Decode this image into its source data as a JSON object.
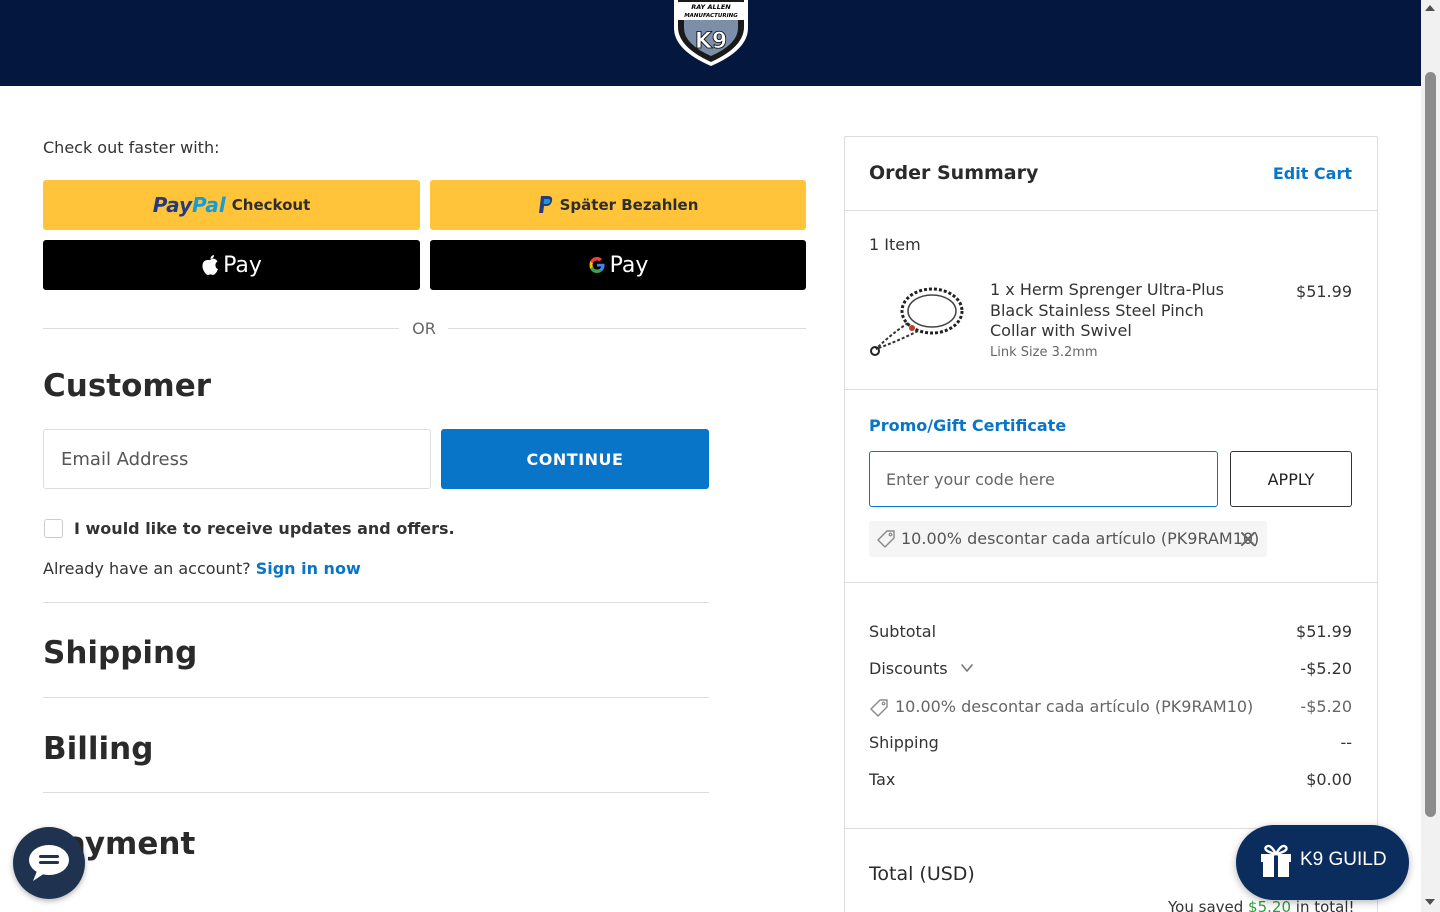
{
  "header": {
    "logo_line1": "RAY ALLEN",
    "logo_line2": "MANUFACTURING",
    "logo_mark": "K9"
  },
  "checkout_faster": {
    "label": "Check out faster with:",
    "paypal_brand_1": "Pay",
    "paypal_brand_2": "Pal",
    "paypal_checkout": "Checkout",
    "paylater_label": "Später Bezahlen",
    "applepay_label": "Pay",
    "googlepay_label": "Pay",
    "or_label": "OR"
  },
  "customer": {
    "title": "Customer",
    "email_placeholder": "Email Address",
    "continue_label": "CONTINUE",
    "updates_label": "I would like to receive updates and offers.",
    "account_prompt": "Already have an account?",
    "signin_label": "Sign in now"
  },
  "sections": {
    "shipping": "Shipping",
    "billing": "Billing",
    "payment": "Payment"
  },
  "summary": {
    "title": "Order Summary",
    "edit_cart": "Edit Cart",
    "item_count": "1 Item",
    "item": {
      "name": "1 x Herm Sprenger Ultra-Plus Black Stainless Steel Pinch Collar with Swivel",
      "option": "Link Size 3.2mm",
      "price": "$51.99"
    },
    "promo": {
      "label": "Promo/Gift Certificate",
      "placeholder": "Enter your code here",
      "apply_label": "APPLY",
      "applied_coupon": "10.00% descontar cada artículo (PK9RAM10)"
    },
    "lines": {
      "subtotal_label": "Subtotal",
      "subtotal_value": "$51.99",
      "discounts_label": "Discounts",
      "discounts_value": "-$5.20",
      "discount_detail_label": "10.00% descontar cada artículo (PK9RAM10)",
      "discount_detail_value": "-$5.20",
      "shipping_label": "Shipping",
      "shipping_value": "--",
      "tax_label": "Tax",
      "tax_value": "$0.00"
    },
    "total_label": "Total (USD)",
    "saved_prefix": "You saved",
    "saved_amount": "$5.20",
    "saved_suffix": "in total!"
  },
  "floating": {
    "guild_label": "K9 GUILD"
  },
  "icons": {
    "chat": "chat-bubble-icon",
    "gift": "gift-icon",
    "tag": "tag-icon",
    "close": "close-icon",
    "chevron": "chevron-down-icon",
    "apple": "apple-icon",
    "google": "google-icon"
  },
  "colors": {
    "header_bg": "#04173f",
    "accent": "#0875c8",
    "paypal_yellow": "#ffc439",
    "saved_green": "#2e9e3f"
  }
}
